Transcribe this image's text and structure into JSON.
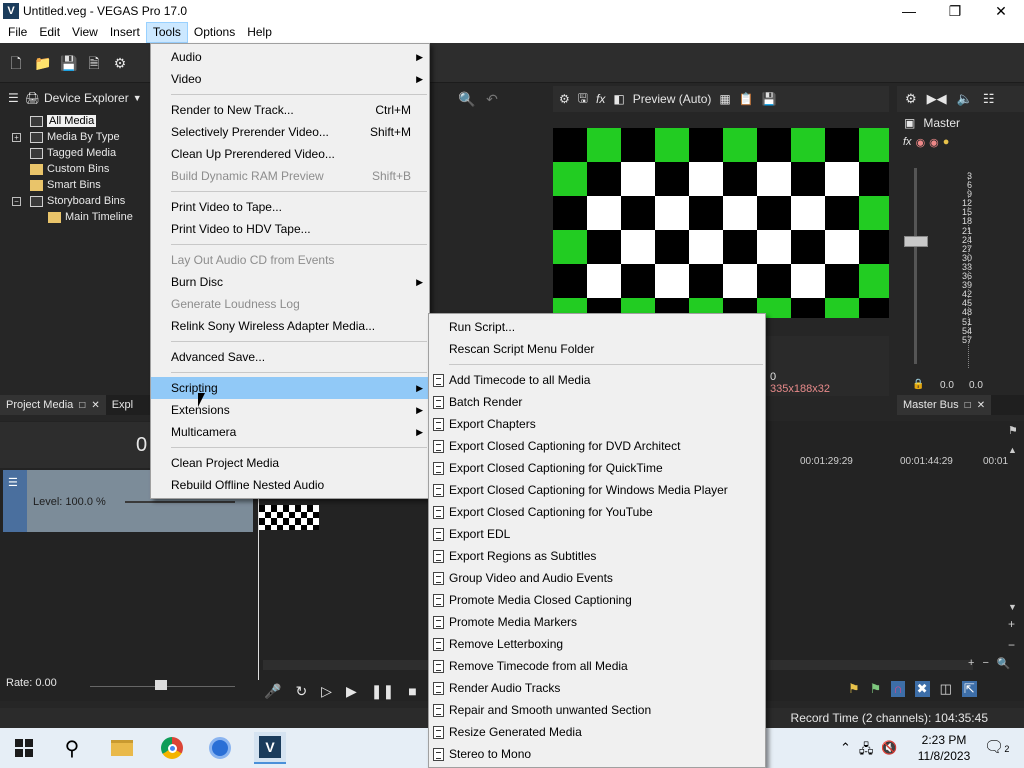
{
  "window": {
    "title": "Untitled.veg - VEGAS Pro 17.0",
    "app_icon": "V"
  },
  "menubar": [
    "File",
    "Edit",
    "View",
    "Insert",
    "Tools",
    "Options",
    "Help"
  ],
  "explorer": {
    "header": "Device Explorer",
    "tree": [
      "All Media",
      "Media By Type",
      "Tagged Media",
      "Custom Bins",
      "Smart Bins",
      "Storyboard Bins",
      "Main Timeline"
    ]
  },
  "tabs_left": [
    "Project Media",
    "Expl"
  ],
  "preview": {
    "mode": "Preview (Auto)",
    "frame_info": "0",
    "display_info": "335x188x32"
  },
  "master": {
    "label": "Master",
    "scale": [
      "3",
      "6",
      "9",
      "12",
      "15",
      "18",
      "21",
      "24",
      "27",
      "30",
      "33",
      "36",
      "39",
      "42",
      "45",
      "48",
      "51",
      "54",
      "57"
    ],
    "peak_left": "0.0",
    "peak_right": "0.0",
    "tab": "Master Bus"
  },
  "timeline": {
    "time_display": "0",
    "track_level": "Level: 100.0 %",
    "ruler": [
      "00:01:29:29",
      "00:01:44:29",
      "00:01"
    ],
    "rate": "Rate: 0.00"
  },
  "statusbar": {
    "record_time": "Record Time (2 channels): 104:35:45"
  },
  "taskbar": {
    "time": "2:23 PM",
    "date": "11/8/2023",
    "notification_count": "2"
  },
  "tools_menu": {
    "groups": [
      [
        {
          "label": "Audio",
          "submenu": true
        },
        {
          "label": "Video",
          "submenu": true
        }
      ],
      [
        {
          "label": "Render to New Track...",
          "shortcut": "Ctrl+M"
        },
        {
          "label": "Selectively Prerender Video...",
          "shortcut": "Shift+M"
        },
        {
          "label": "Clean Up Prerendered Video..."
        },
        {
          "label": "Build Dynamic RAM Preview",
          "shortcut": "Shift+B",
          "disabled": true
        }
      ],
      [
        {
          "label": "Print Video to Tape..."
        },
        {
          "label": "Print Video to HDV Tape..."
        }
      ],
      [
        {
          "label": "Lay Out Audio CD from Events",
          "disabled": true
        },
        {
          "label": "Burn Disc",
          "submenu": true
        },
        {
          "label": "Generate Loudness Log",
          "disabled": true
        },
        {
          "label": "Relink Sony Wireless Adapter Media..."
        }
      ],
      [
        {
          "label": "Advanced Save..."
        }
      ],
      [
        {
          "label": "Scripting",
          "submenu": true,
          "highlight": true
        },
        {
          "label": "Extensions",
          "submenu": true
        },
        {
          "label": "Multicamera",
          "submenu": true
        }
      ],
      [
        {
          "label": "Clean Project Media"
        },
        {
          "label": "Rebuild Offline Nested Audio"
        }
      ]
    ]
  },
  "scripting_menu": {
    "top": [
      "Run Script...",
      "Rescan Script Menu Folder"
    ],
    "scripts": [
      "Add Timecode to all Media",
      "Batch Render",
      "Export Chapters",
      "Export Closed Captioning for DVD Architect",
      "Export Closed Captioning for QuickTime",
      "Export Closed Captioning for Windows Media Player",
      "Export Closed Captioning for YouTube",
      "Export EDL",
      "Export Regions as Subtitles",
      "Group Video and Audio Events",
      "Promote Media Closed Captioning",
      "Promote Media Markers",
      "Remove Letterboxing",
      "Remove Timecode from all Media",
      "Render Audio Tracks",
      "Repair and Smooth unwanted Section",
      "Resize Generated Media",
      "Stereo to Mono"
    ]
  }
}
